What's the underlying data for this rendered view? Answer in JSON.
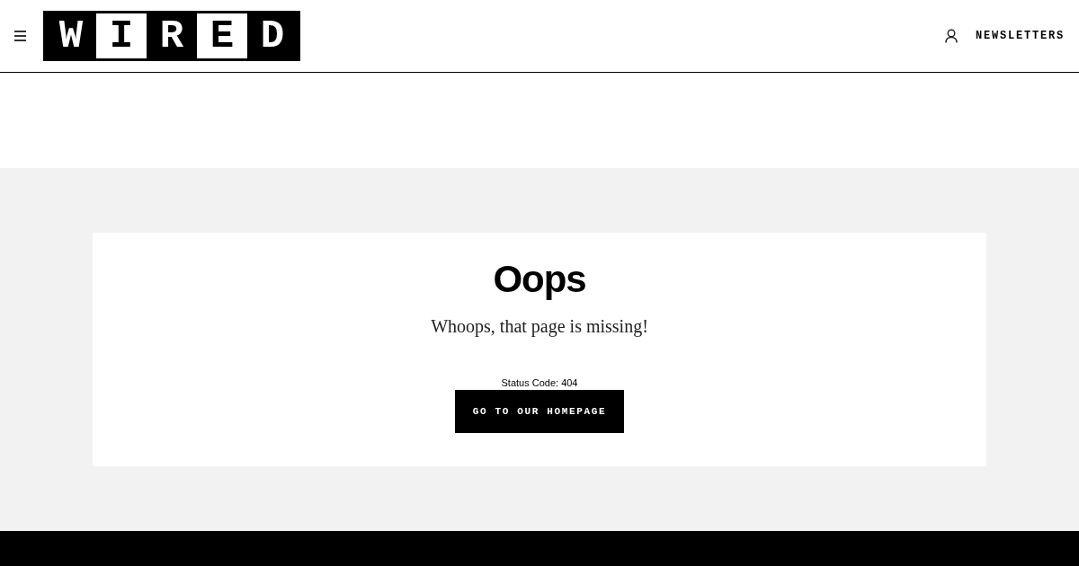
{
  "header": {
    "logo_letters": [
      "W",
      "I",
      "R",
      "E",
      "D"
    ],
    "newsletters_link": "NEWSLETTERS"
  },
  "error_card": {
    "title": "Oops",
    "message": "Whoops, that page is missing!",
    "status": "Status Code: 404",
    "button": "GO TO OUR HOMEPAGE"
  }
}
